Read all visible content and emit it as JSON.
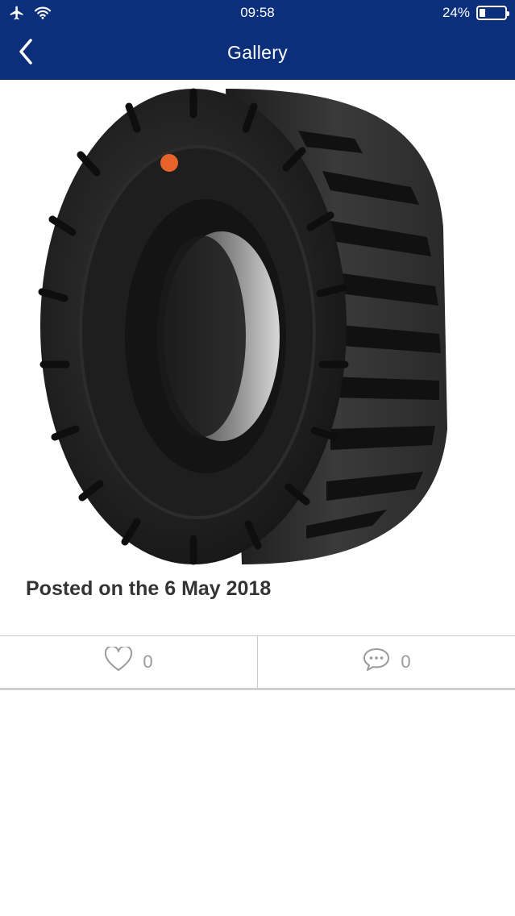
{
  "status_bar": {
    "time": "09:58",
    "battery_percent_label": "24%",
    "battery_level": 0.24,
    "left_icons": [
      "airplane-icon",
      "wifi-icon"
    ]
  },
  "nav": {
    "title": "Gallery",
    "back_icon": "chevron-left-icon"
  },
  "post": {
    "image_subject": "solid forklift tire",
    "caption": "Posted on the 6 May 2018",
    "likes_count": "0",
    "comments_count": "0"
  },
  "colors": {
    "header_bg": "#0b2f7a",
    "caption_text": "#333333",
    "action_icon": "#9a9a9a"
  }
}
